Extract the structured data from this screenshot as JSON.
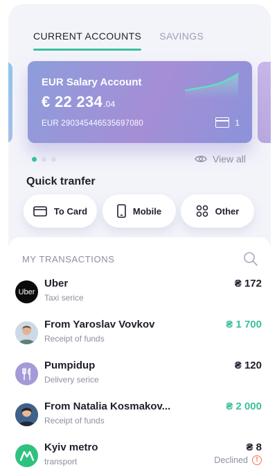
{
  "tabs": [
    {
      "label": "CURRENT ACCOUNTS",
      "active": true
    },
    {
      "label": "SAVINGS",
      "active": false
    }
  ],
  "card": {
    "title": "EUR Salary Account",
    "balance_main": "€ 22 234",
    "balance_cents": ".04",
    "iban": "EUR 290345446535697080",
    "card_count": "1"
  },
  "carousel": {
    "total": 3,
    "active_index": 0
  },
  "view_all_label": "View all",
  "quick_transfer": {
    "title": "Quick tranfer",
    "buttons": [
      {
        "label": "To Card",
        "icon": "card-icon"
      },
      {
        "label": "Mobile",
        "icon": "phone-icon"
      },
      {
        "label": "Other",
        "icon": "grid-icon"
      }
    ]
  },
  "transactions": {
    "header": "MY TRANSACTIONS",
    "items": [
      {
        "name": "Uber",
        "subtitle": "Taxi serice",
        "amount": "₴ 172",
        "positive": false,
        "avatar": "uber-logo",
        "avatar_text": "Uber",
        "status": ""
      },
      {
        "name": "From Yaroslav Vovkov",
        "subtitle": "Receipt of funds",
        "amount": "₴ 1 700",
        "positive": true,
        "avatar": "user-photo",
        "avatar_text": "",
        "status": ""
      },
      {
        "name": "Pumpidup",
        "subtitle": "Delivery serice",
        "amount": "₴ 120",
        "positive": false,
        "avatar": "fork-knife-icon",
        "avatar_text": "",
        "status": ""
      },
      {
        "name": "From Natalia Kosmakov...",
        "subtitle": "Receipt of funds",
        "amount": "₴ 2 000",
        "positive": true,
        "avatar": "user-photo",
        "avatar_text": "",
        "status": ""
      },
      {
        "name": "Kyiv metro",
        "subtitle": "transport",
        "amount": "₴ 8",
        "positive": false,
        "avatar": "metro-logo",
        "avatar_text": "",
        "status": "Declined"
      }
    ]
  },
  "colors": {
    "accent": "#3bbf9d",
    "card_gradient_start": "#8d9ddb",
    "card_gradient_end": "#a58ed6",
    "declined": "#ff6b4a",
    "metro": "#2ec27e",
    "delivery": "#a59ad8"
  }
}
